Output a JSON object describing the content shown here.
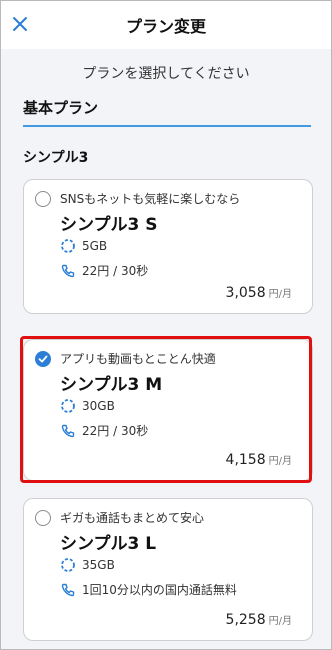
{
  "header": {
    "title": "プラン変更",
    "close_icon": "close-icon"
  },
  "subtitle": "プランを選択してください",
  "section_tab": "基本プラン",
  "group_title": "シンプル3",
  "colors": {
    "accent": "#2a7fd4",
    "selection_outline": "#e01010"
  },
  "plans": [
    {
      "tagline": "SNSもネットも気軽に楽しむなら",
      "name": "シンプル3 S",
      "data": "5GB",
      "call": "22円 / 30秒",
      "price": "3,058",
      "unit": "円/月",
      "selected": false
    },
    {
      "tagline": "アプリも動画もとことん快適",
      "name": "シンプル3 M",
      "data": "30GB",
      "call": "22円 / 30秒",
      "price": "4,158",
      "unit": "円/月",
      "selected": true
    },
    {
      "tagline": "ギガも通話もまとめて安心",
      "name": "シンプル3 L",
      "data": "35GB",
      "call": "1回10分以内の国内通話無料",
      "price": "5,258",
      "unit": "円/月",
      "selected": false
    }
  ]
}
